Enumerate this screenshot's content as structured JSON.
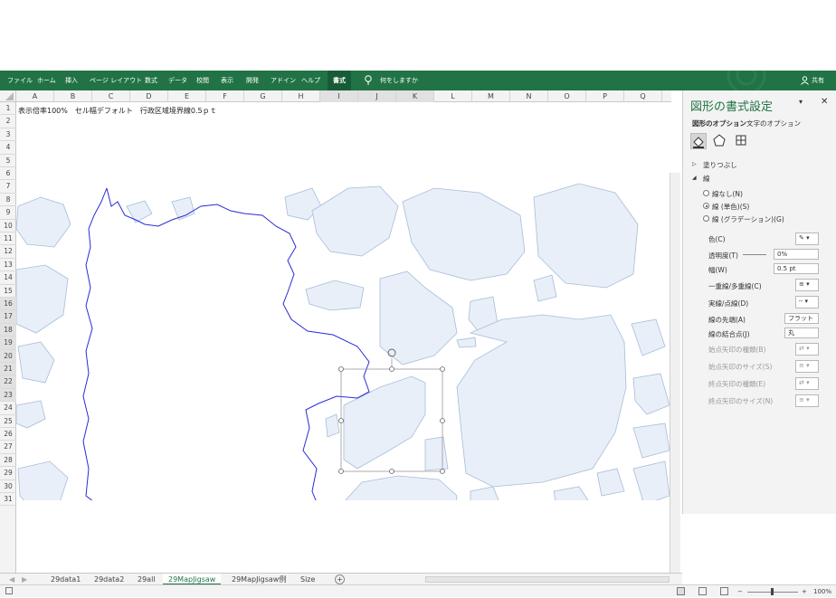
{
  "ribbon": {
    "tabs": [
      {
        "label": "ファイル"
      },
      {
        "label": "ホーム"
      },
      {
        "label": "挿入"
      },
      {
        "label": "ページ レイアウト"
      },
      {
        "label": "数式"
      },
      {
        "label": "データ"
      },
      {
        "label": "校閲"
      },
      {
        "label": "表示"
      },
      {
        "label": "開発"
      },
      {
        "label": "アドイン"
      },
      {
        "label": "ヘルプ"
      },
      {
        "label": "書式"
      }
    ],
    "tell_me": "何をしますか",
    "share": "共有"
  },
  "columns": [
    "A",
    "B",
    "C",
    "D",
    "E",
    "F",
    "G",
    "H",
    "I",
    "J",
    "K",
    "L",
    "M",
    "N",
    "O",
    "P",
    "Q"
  ],
  "rows": [
    "1",
    "2",
    "3",
    "4",
    "5",
    "6",
    "7",
    "8",
    "9",
    "10",
    "11",
    "12",
    "13",
    "14",
    "15",
    "16",
    "17",
    "18",
    "19",
    "20",
    "21",
    "22",
    "23",
    "24",
    "25",
    "26",
    "27",
    "28",
    "29",
    "30",
    "31"
  ],
  "cell_a1": "表示倍率100%　セル幅デフォルト　行政区域境界線0.5ｐｔ",
  "sheet_tabs": [
    "29data1",
    "29data2",
    "29all",
    "29MapJigsaw",
    "29MapJigsaw例",
    "Size"
  ],
  "active_sheet": "29MapJigsaw",
  "status": {
    "zoom": "100%"
  },
  "pane": {
    "title": "図形の書式設定",
    "tab_shape": "図形のオプション",
    "tab_text": "文字のオプション",
    "fill_label": "塗りつぶし",
    "line_label": "線",
    "radio_none": "線なし(N)",
    "radio_solid": "線 (単色)(S)",
    "radio_gradient": "線 (グラデーション)(G)",
    "color": "色(C)",
    "transparency": "透明度(T)",
    "transparency_value": "0%",
    "width": "幅(W)",
    "width_value": "0.5 pt",
    "compound": "一重線/多重線(C)",
    "dash": "実線/点線(D)",
    "cap": "線の先端(A)",
    "cap_value": "フラット",
    "join": "線の結合点(J)",
    "join_value": "丸",
    "begin_arrow_type": "始点矢印の種類(B)",
    "begin_arrow_size": "始点矢印のサイズ(S)",
    "end_arrow_type": "終点矢印の種類(E)",
    "end_arrow_size": "終点矢印のサイズ(N)"
  },
  "colors": {
    "ribbon": "#217346",
    "shape_fill": "#e8eff8",
    "shape_stroke": "#a7bdd8",
    "boundary": "#2b2bd8"
  }
}
